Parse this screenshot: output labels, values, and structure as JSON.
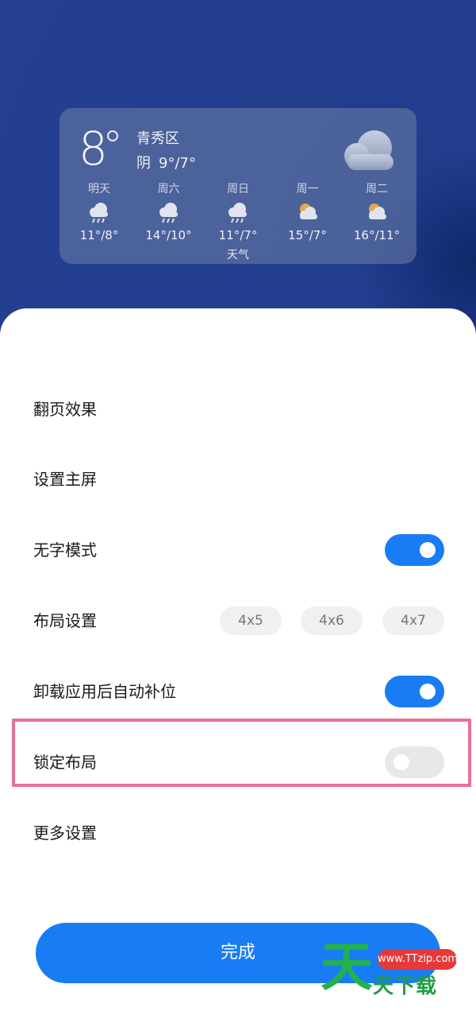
{
  "weather": {
    "temperature": "8",
    "city": "青秀区",
    "condition": "阴",
    "range": "9°/7°",
    "widget_label": "天气",
    "forecast": [
      {
        "day": "明天",
        "range": "11°/8°",
        "icon": "rain-icon"
      },
      {
        "day": "周六",
        "range": "14°/10°",
        "icon": "rain-icon"
      },
      {
        "day": "周日",
        "range": "11°/7°",
        "icon": "rain-icon"
      },
      {
        "day": "周一",
        "range": "15°/7°",
        "icon": "partly-cloudy-icon"
      },
      {
        "day": "周二",
        "range": "16°/11°",
        "icon": "partly-cloudy-icon"
      }
    ]
  },
  "settings": {
    "page_turn_effect": "翻页效果",
    "set_home_screen": "设置主屏",
    "no_text_mode": "无字模式",
    "no_text_mode_on": true,
    "layout_settings": "布局设置",
    "layout_options": [
      "4x5",
      "4x6",
      "4x7"
    ],
    "auto_fill_after_uninstall": "卸载应用后自动补位",
    "auto_fill_on": true,
    "lock_layout": "锁定布局",
    "lock_layout_on": false,
    "more_settings": "更多设置"
  },
  "done_label": "完成",
  "watermark": {
    "char": "天",
    "url": "www.TTzip.com",
    "text": "天下载"
  },
  "colors": {
    "accent": "#1a7cf5",
    "highlight_border": "#e8709a",
    "wallpaper": "#233d8d"
  }
}
